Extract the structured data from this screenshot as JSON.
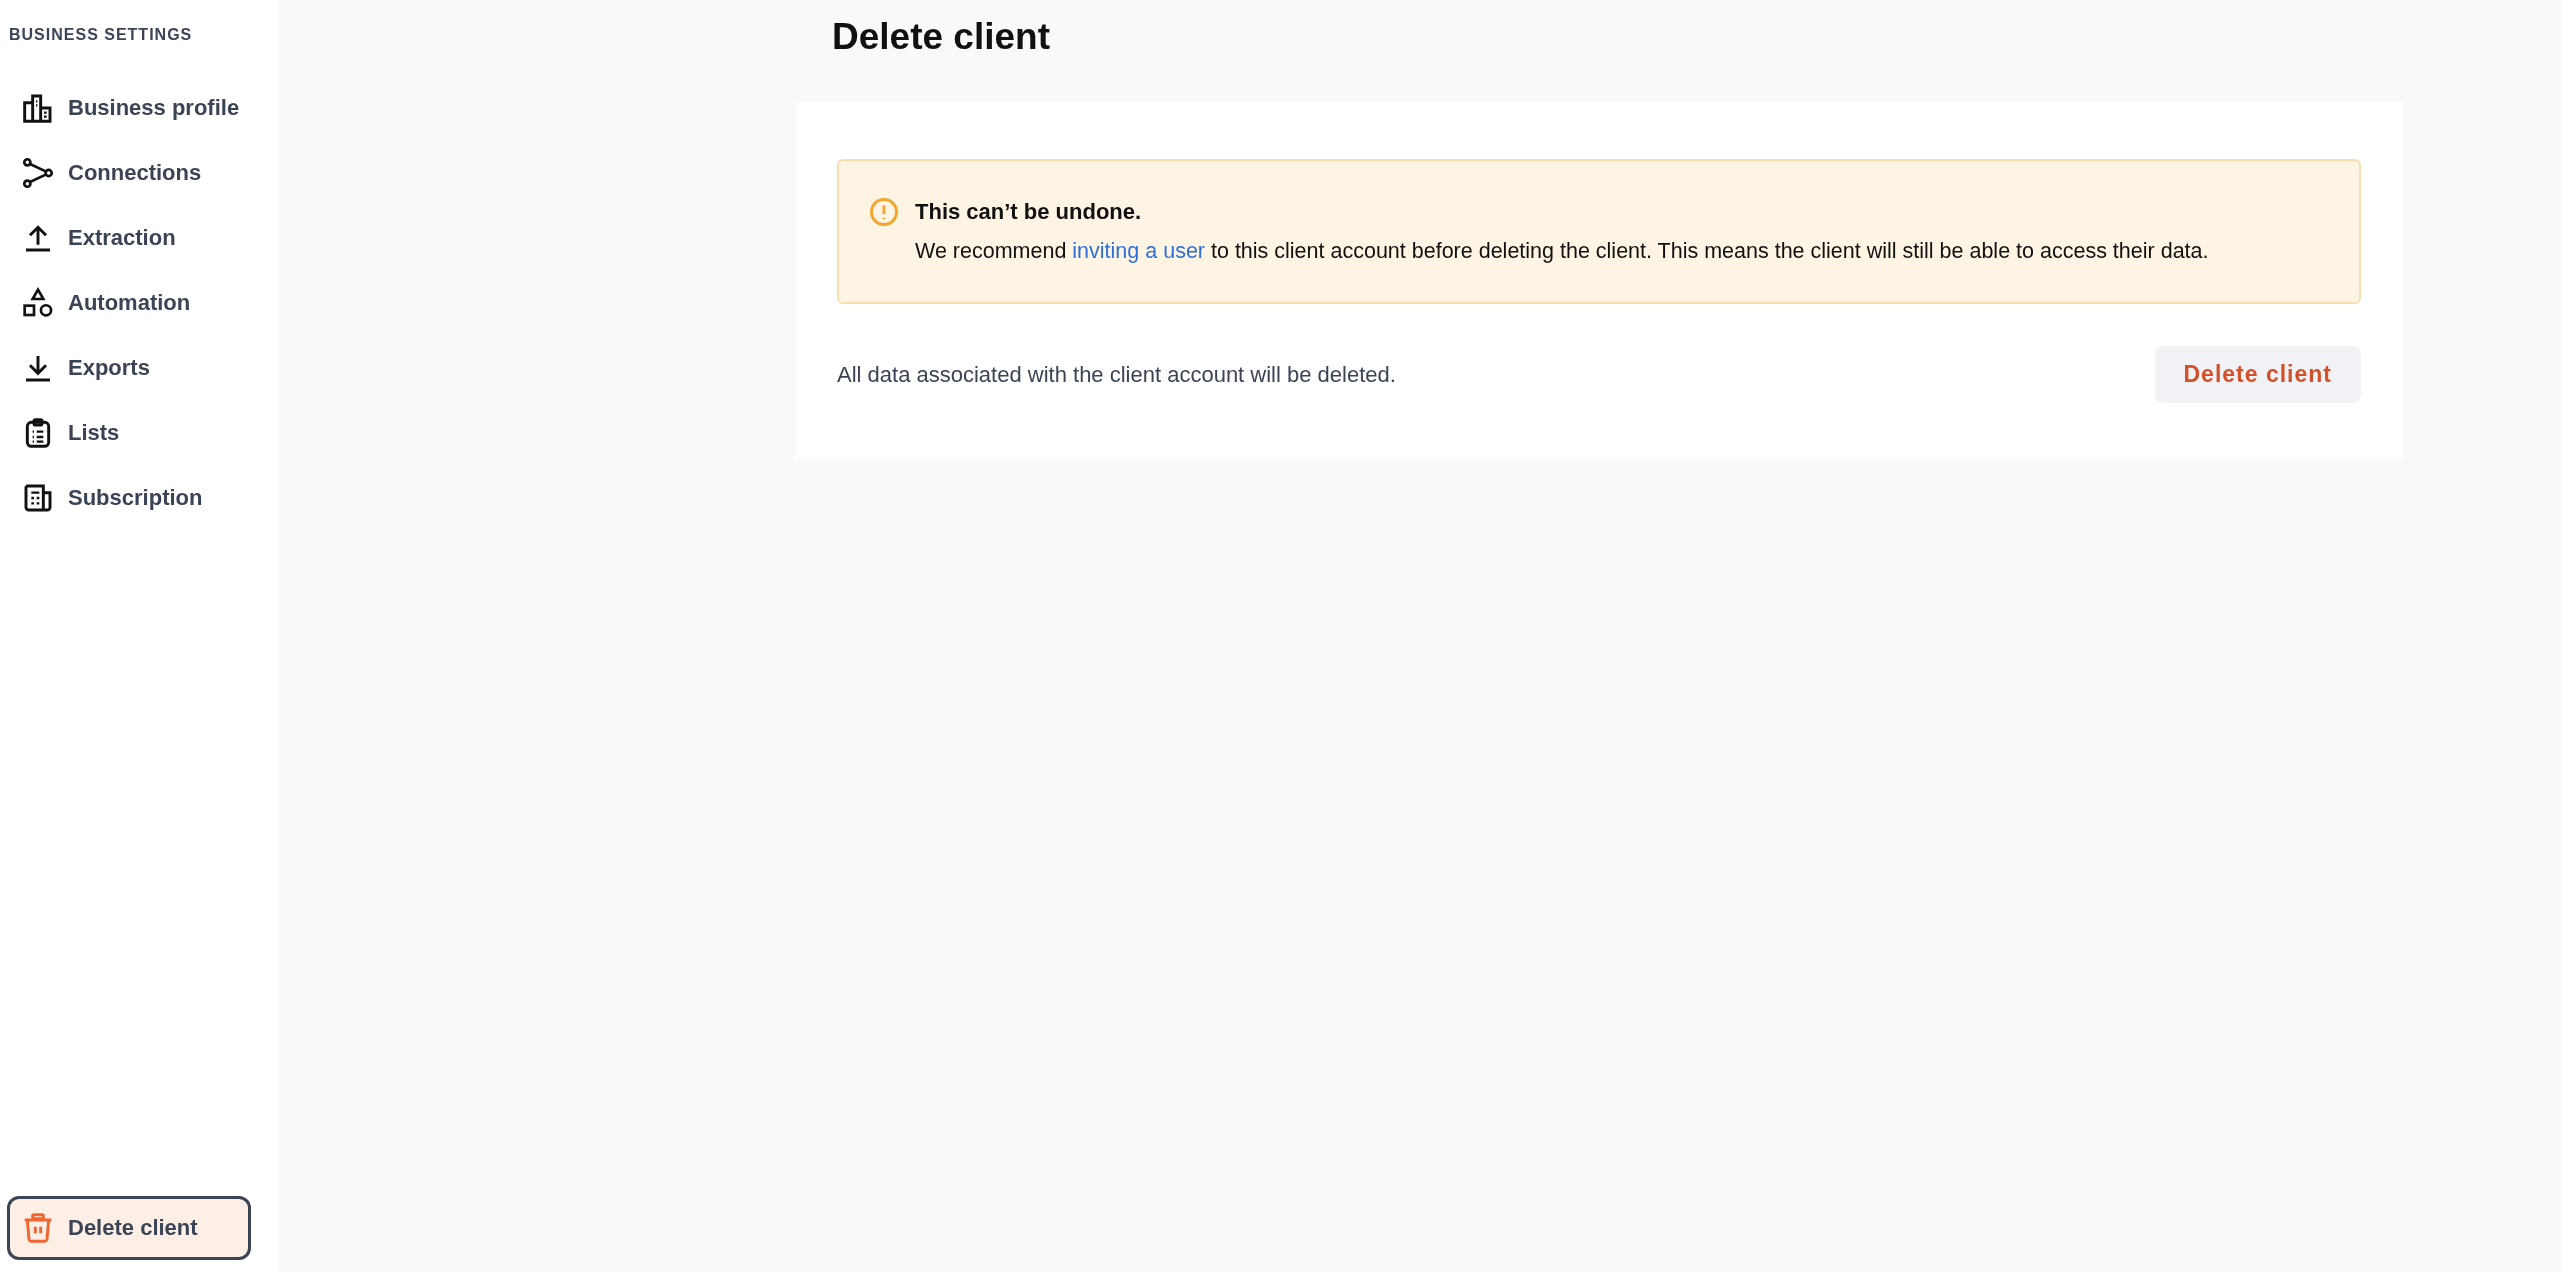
{
  "sidebar": {
    "heading": "BUSINESS SETTINGS",
    "items": [
      {
        "label": "Business profile",
        "kind": "buildings",
        "selected": false
      },
      {
        "label": "Connections",
        "kind": "connections",
        "selected": false
      },
      {
        "label": "Extraction",
        "kind": "upload",
        "selected": false
      },
      {
        "label": "Automation",
        "kind": "shapes",
        "selected": false
      },
      {
        "label": "Exports",
        "kind": "download",
        "selected": false
      },
      {
        "label": "Lists",
        "kind": "clipboard",
        "selected": false
      },
      {
        "label": "Subscription",
        "kind": "newspaper",
        "selected": false
      }
    ],
    "footer_item": {
      "label": "Delete client",
      "kind": "trash",
      "selected": true
    }
  },
  "page_title": "Delete client",
  "warning": {
    "title": "This can’t be undone.",
    "text_before": "We recommend",
    "link": "inviting a user",
    "text_after": "to this client account before deleting the client. This means the client will still be able to access their data."
  },
  "description": "All data associated with the client account will be deleted.",
  "delete_button": "Delete client"
}
